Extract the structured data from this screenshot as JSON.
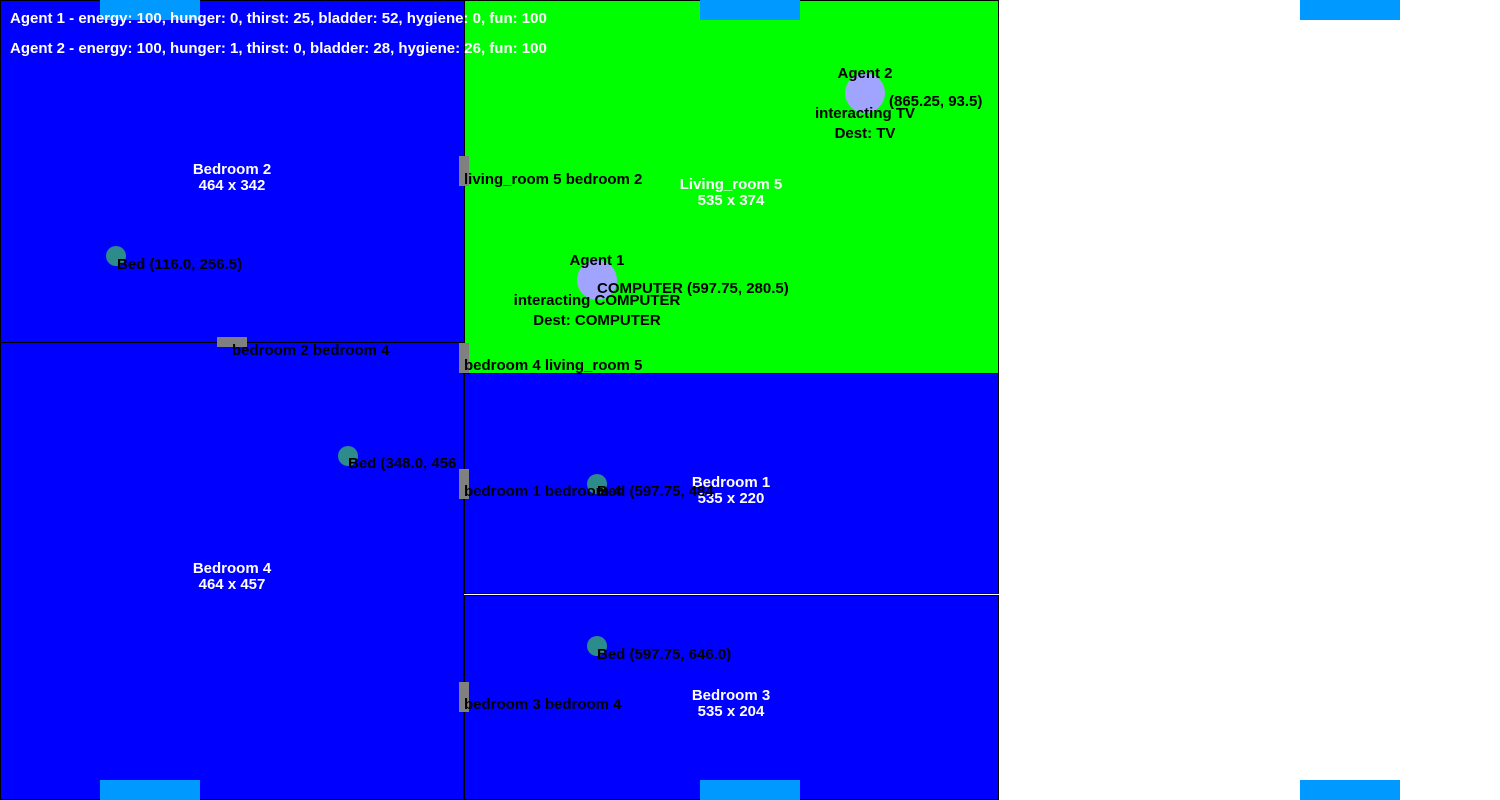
{
  "stats": {
    "agent1": "Agent 1 - energy: 100, hunger: 0, thirst: 25, bladder: 52, hygiene: 0, fun: 100",
    "agent2": "Agent 2 - energy: 100, hunger: 1, thirst: 0, bladder: 28, hygiene: 26, fun: 100"
  },
  "colors": {
    "bedroom": "#0000ff",
    "living_room": "#00ff00",
    "door": "#808080",
    "bed": "#2e8b8b",
    "agent": "#a0a4ff",
    "marker": "#0099ff"
  },
  "rooms": {
    "bedroom2": {
      "name": "Bedroom 2",
      "size": "464 x 342"
    },
    "living_room5": {
      "name": "Living_room 5",
      "size": "535 x 374"
    },
    "bedroom4": {
      "name": "Bedroom 4",
      "size": "464 x 457"
    },
    "bedroom1": {
      "name": "Bedroom 1",
      "size": "535 x 220"
    },
    "bedroom3": {
      "name": "Bedroom 3",
      "size": "535 x 204"
    }
  },
  "doors": {
    "lr5_b2": "living_room 5 bedroom 2",
    "b2_b4": "bedroom 2 bedroom 4",
    "b4_lr5": "bedroom 4 living_room 5",
    "b1_b4": "bedroom 1 bedroom 4",
    "b3_b4": "bedroom 3 bedroom 4"
  },
  "objects": {
    "bed_b2": "Bed (116.0, 256.5)",
    "bed_b4": "Bed (348.0, 456",
    "bed_b1": "Bed (597.75, 484",
    "bed_b3": "Bed (597.75, 646.0)",
    "computer": "COMPUTER (597.75, 280.5)",
    "tv": "(865.25, 93.5)"
  },
  "agents": {
    "agent1": {
      "name": "Agent 1",
      "state": "interacting COMPUTER",
      "dest": "Dest: COMPUTER"
    },
    "agent2": {
      "name": "Agent 2",
      "state": "interacting TV",
      "dest": "Dest: TV"
    }
  }
}
